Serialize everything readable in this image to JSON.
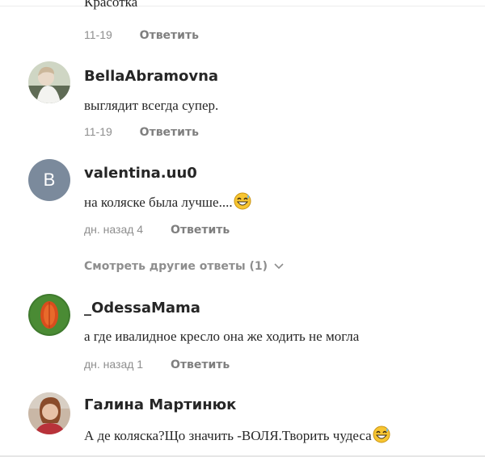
{
  "partial_comment": {
    "text": "Красотка",
    "date": "11-19",
    "reply_label": "Ответить"
  },
  "comments": [
    {
      "username": "BellaAbramovna",
      "text": "выглядит всегда супер.",
      "date": "11-19",
      "reply_label": "Ответить",
      "avatar": "photo"
    },
    {
      "username": "valentina.uu0",
      "text": "на коляске была лучше....",
      "emoji": "grinning-sweat-emoji",
      "date": "дн. назад 4",
      "reply_label": "Ответить",
      "avatar_letter": "B",
      "avatar_color": "#7b8a9c"
    },
    {
      "username": "_OdessaMama",
      "text": "а где ивалидное кресло она же ходить не могла",
      "date": "дн. назад 1",
      "reply_label": "Ответить",
      "avatar": "photo"
    },
    {
      "username": "Галина Мартинюк",
      "text": "А де коляска?Що значить -ВОЛЯ.Творить чудеса",
      "emoji": "grinning-sweat-emoji",
      "avatar": "photo"
    }
  ],
  "view_more": {
    "label": "Смотреть другие ответы (1)",
    "icon": "chevron-down-icon"
  },
  "colors": {
    "text": "#262626",
    "meta": "#8e8e8e",
    "avatar_letter_bg": "#7b8a9c"
  }
}
